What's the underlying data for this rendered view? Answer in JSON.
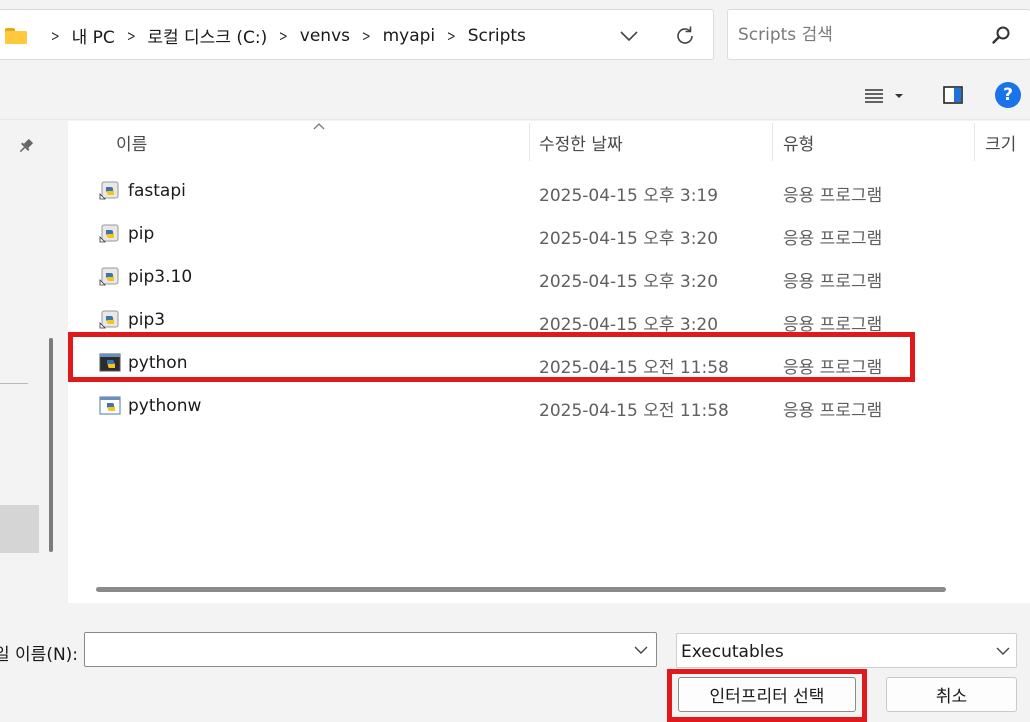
{
  "address_bar": {
    "breadcrumbs": [
      "내 PC",
      "로컬 디스크 (C:)",
      "venvs",
      "myapi",
      "Scripts"
    ],
    "search_placeholder": "Scripts 검색"
  },
  "toolbar": {
    "help_label": "?"
  },
  "sidebar": {
    "selected_item_fragment": ")"
  },
  "file_list": {
    "columns": [
      "이름",
      "수정한 날짜",
      "유형",
      "크기"
    ],
    "rows": [
      {
        "name": "fastapi",
        "modified": "2025-04-15 오후 3:19",
        "type": "응용 프로그램",
        "icon": "python-launcher-icon"
      },
      {
        "name": "pip",
        "modified": "2025-04-15 오후 3:20",
        "type": "응용 프로그램",
        "icon": "python-launcher-icon"
      },
      {
        "name": "pip3.10",
        "modified": "2025-04-15 오후 3:20",
        "type": "응용 프로그램",
        "icon": "python-launcher-icon"
      },
      {
        "name": "pip3",
        "modified": "2025-04-15 오후 3:20",
        "type": "응용 프로그램",
        "icon": "python-launcher-icon"
      },
      {
        "name": "python",
        "modified": "2025-04-15 오전 11:58",
        "type": "응용 프로그램",
        "icon": "python-console-icon"
      },
      {
        "name": "pythonw",
        "modified": "2025-04-15 오전 11:58",
        "type": "응용 프로그램",
        "icon": "python-window-icon"
      }
    ]
  },
  "bottom": {
    "filename_label": "일 이름(N):",
    "filename_value": "",
    "file_type_selected": "Executables",
    "select_button": "인터프리터 선택",
    "cancel_button": "취소"
  },
  "colors": {
    "highlight": "#e01a1a",
    "help_blue": "#1a73e8",
    "folder_yellow": "#ffc83d"
  }
}
